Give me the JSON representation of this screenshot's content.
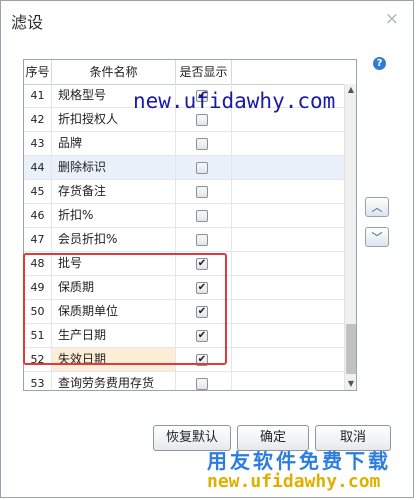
{
  "dialog": {
    "title": "滤设"
  },
  "grid": {
    "headers": {
      "no": "序号",
      "name": "条件名称",
      "show": "是否显示"
    },
    "rows": [
      {
        "no": "41",
        "name": "规格型号",
        "checked": true
      },
      {
        "no": "42",
        "name": "折扣授权人",
        "checked": false
      },
      {
        "no": "43",
        "name": "品牌",
        "checked": false
      },
      {
        "no": "44",
        "name": "删除标识",
        "checked": false
      },
      {
        "no": "45",
        "name": "存货备注",
        "checked": false
      },
      {
        "no": "46",
        "name": "折扣%",
        "checked": false
      },
      {
        "no": "47",
        "name": "会员折扣%",
        "checked": false
      },
      {
        "no": "48",
        "name": "批号",
        "checked": true
      },
      {
        "no": "49",
        "name": "保质期",
        "checked": true
      },
      {
        "no": "50",
        "name": "保质期单位",
        "checked": true
      },
      {
        "no": "51",
        "name": "生产日期",
        "checked": true
      },
      {
        "no": "52",
        "name": "失效日期",
        "checked": true
      },
      {
        "no": "53",
        "name": "查询劳务费用存货",
        "checked": false
      }
    ]
  },
  "icons": {
    "help": "?",
    "close": "×",
    "move_up": "︿",
    "move_down": "﹀",
    "scroll_up": "▲",
    "scroll_down": "▼"
  },
  "buttons": {
    "reset": "恢复默认",
    "ok": "确定",
    "cancel": "取消"
  },
  "watermarks": {
    "url_top": "new.ufidawhy.com",
    "cn_bottom": "用友软件免费下载",
    "url_bottom": "new.ufidawhy.com"
  },
  "colors": {
    "highlight_box": "#e03a3a",
    "selected_row": "#eaf1fb",
    "focused_cell": "#fdeed8"
  }
}
